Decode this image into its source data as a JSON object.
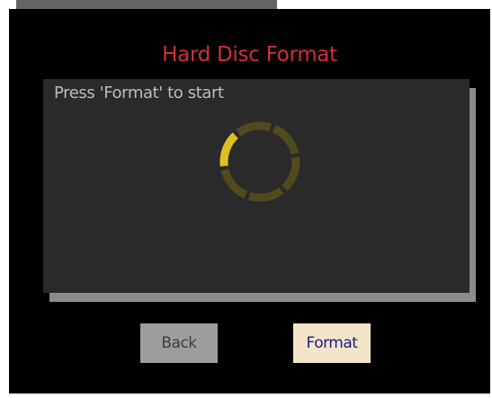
{
  "dialog": {
    "title": "Hard Disc Format",
    "prompt": "Press 'Format' to start"
  },
  "buttons": {
    "back_label": "Back",
    "format_label": "Format"
  },
  "spinner": {
    "icon": "loading-ring-icon",
    "segments": 6,
    "active_segment": 0
  },
  "colors": {
    "title": "#d0303b",
    "panel": "#2a2a2a",
    "spinner_active": "#e0c020",
    "spinner_inactive": "#514a1e",
    "format_button_bg": "#f3e5c8",
    "back_button_bg": "#9d9d9d"
  }
}
